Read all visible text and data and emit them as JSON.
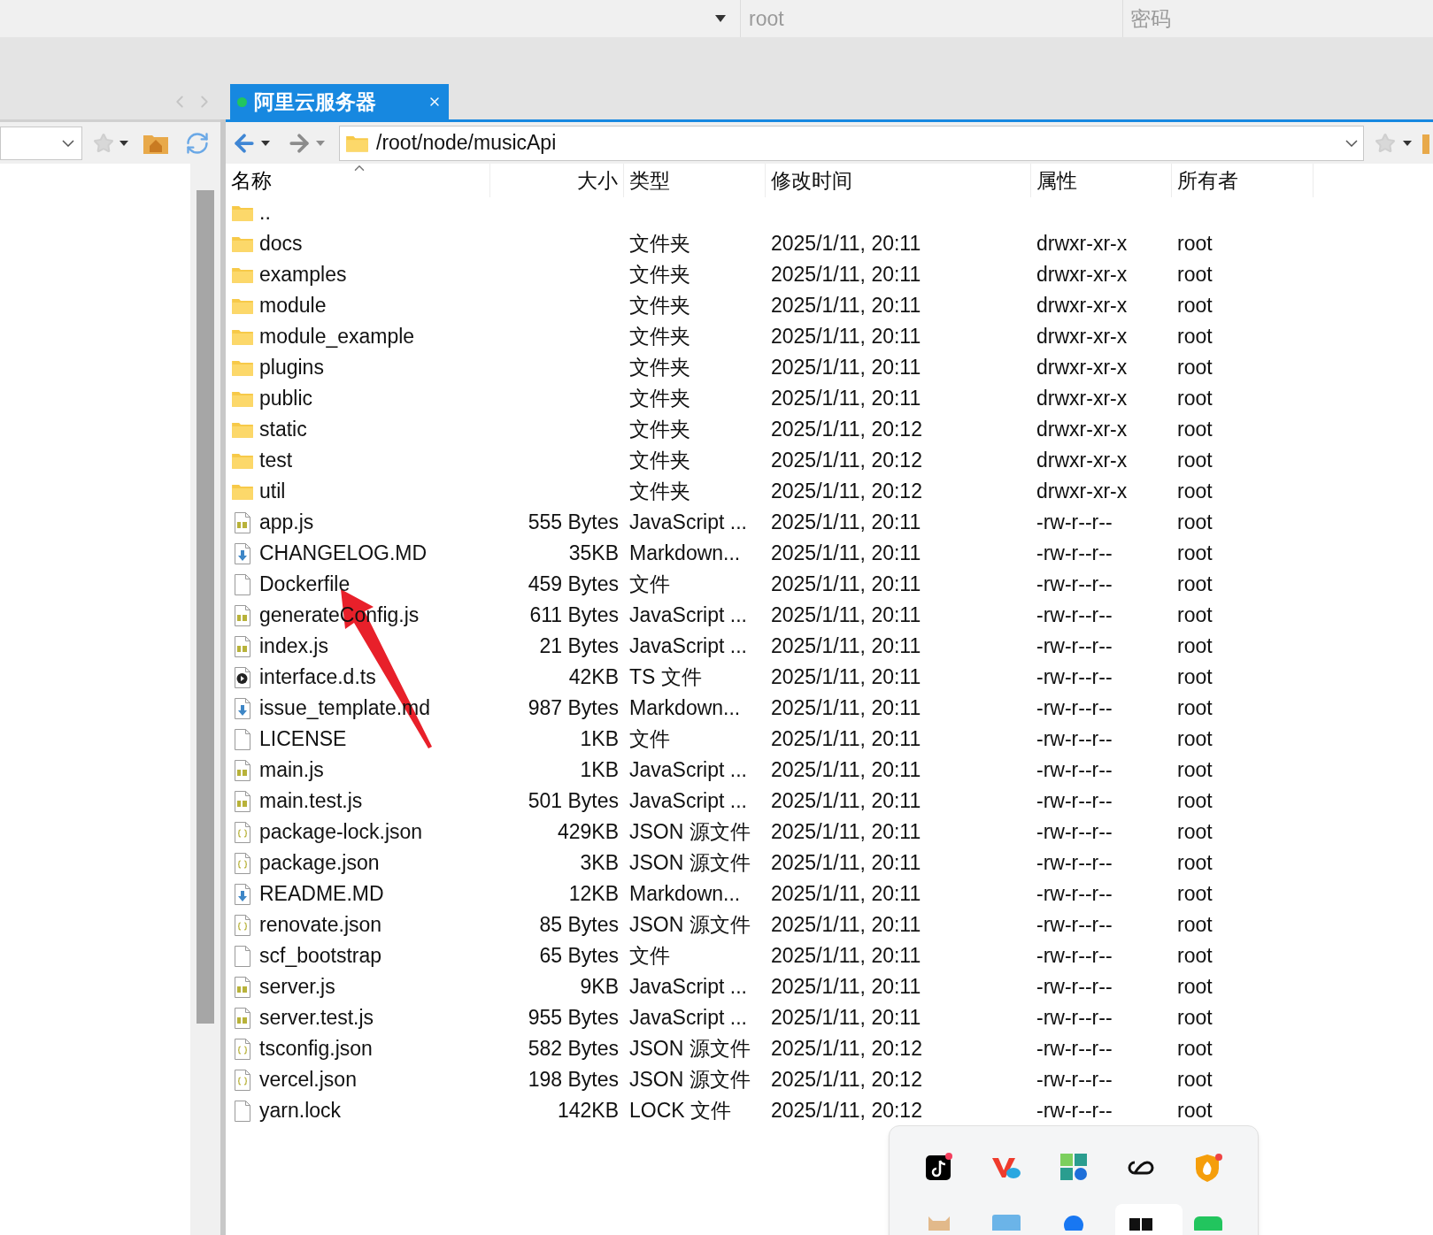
{
  "login_bar": {
    "user_field": {
      "placeholder": "root"
    },
    "password_field": {
      "placeholder": "密码"
    }
  },
  "tabs": [
    {
      "label": "阿里云服务器",
      "selected": true,
      "connected": true
    }
  ],
  "remote": {
    "path": "/root/node/musicApi",
    "columns": [
      {
        "label": "名称",
        "sorted": true
      },
      {
        "label": "大小",
        "sorted": false
      },
      {
        "label": "类型",
        "sorted": false
      },
      {
        "label": "修改时间",
        "sorted": false
      },
      {
        "label": "属性",
        "sorted": false
      },
      {
        "label": "所有者",
        "sorted": false
      }
    ],
    "rows": [
      {
        "kind": "folder",
        "name": ".."
      },
      {
        "kind": "folder",
        "name": "docs",
        "type": "文件夹",
        "modified": "2025/1/11, 20:11",
        "attrs": "drwxr-xr-x",
        "owner": "root"
      },
      {
        "kind": "folder",
        "name": "examples",
        "type": "文件夹",
        "modified": "2025/1/11, 20:11",
        "attrs": "drwxr-xr-x",
        "owner": "root"
      },
      {
        "kind": "folder",
        "name": "module",
        "type": "文件夹",
        "modified": "2025/1/11, 20:11",
        "attrs": "drwxr-xr-x",
        "owner": "root"
      },
      {
        "kind": "folder",
        "name": "module_example",
        "type": "文件夹",
        "modified": "2025/1/11, 20:11",
        "attrs": "drwxr-xr-x",
        "owner": "root"
      },
      {
        "kind": "folder",
        "name": "plugins",
        "type": "文件夹",
        "modified": "2025/1/11, 20:11",
        "attrs": "drwxr-xr-x",
        "owner": "root"
      },
      {
        "kind": "folder",
        "name": "public",
        "type": "文件夹",
        "modified": "2025/1/11, 20:11",
        "attrs": "drwxr-xr-x",
        "owner": "root"
      },
      {
        "kind": "folder",
        "name": "static",
        "type": "文件夹",
        "modified": "2025/1/11, 20:12",
        "attrs": "drwxr-xr-x",
        "owner": "root"
      },
      {
        "kind": "folder",
        "name": "test",
        "type": "文件夹",
        "modified": "2025/1/11, 20:12",
        "attrs": "drwxr-xr-x",
        "owner": "root"
      },
      {
        "kind": "folder",
        "name": "util",
        "type": "文件夹",
        "modified": "2025/1/11, 20:12",
        "attrs": "drwxr-xr-x",
        "owner": "root"
      },
      {
        "kind": "js",
        "name": "app.js",
        "size": "555 Bytes",
        "type": "JavaScript ...",
        "modified": "2025/1/11, 20:11",
        "attrs": "-rw-r--r--",
        "owner": "root"
      },
      {
        "kind": "markdown",
        "name": "CHANGELOG.MD",
        "size": "35KB",
        "type": "Markdown...",
        "modified": "2025/1/11, 20:11",
        "attrs": "-rw-r--r--",
        "owner": "root"
      },
      {
        "kind": "file",
        "name": "Dockerfile",
        "size": "459 Bytes",
        "type": "文件",
        "modified": "2025/1/11, 20:11",
        "attrs": "-rw-r--r--",
        "owner": "root"
      },
      {
        "kind": "js",
        "name": "generateConfig.js",
        "size": "611 Bytes",
        "type": "JavaScript ...",
        "modified": "2025/1/11, 20:11",
        "attrs": "-rw-r--r--",
        "owner": "root"
      },
      {
        "kind": "js",
        "name": "index.js",
        "size": "21 Bytes",
        "type": "JavaScript ...",
        "modified": "2025/1/11, 20:11",
        "attrs": "-rw-r--r--",
        "owner": "root"
      },
      {
        "kind": "ts",
        "name": "interface.d.ts",
        "size": "42KB",
        "type": "TS 文件",
        "modified": "2025/1/11, 20:11",
        "attrs": "-rw-r--r--",
        "owner": "root"
      },
      {
        "kind": "markdown",
        "name": "issue_template.md",
        "size": "987 Bytes",
        "type": "Markdown...",
        "modified": "2025/1/11, 20:11",
        "attrs": "-rw-r--r--",
        "owner": "root"
      },
      {
        "kind": "file",
        "name": "LICENSE",
        "size": "1KB",
        "type": "文件",
        "modified": "2025/1/11, 20:11",
        "attrs": "-rw-r--r--",
        "owner": "root"
      },
      {
        "kind": "js",
        "name": "main.js",
        "size": "1KB",
        "type": "JavaScript ...",
        "modified": "2025/1/11, 20:11",
        "attrs": "-rw-r--r--",
        "owner": "root"
      },
      {
        "kind": "js",
        "name": "main.test.js",
        "size": "501 Bytes",
        "type": "JavaScript ...",
        "modified": "2025/1/11, 20:11",
        "attrs": "-rw-r--r--",
        "owner": "root"
      },
      {
        "kind": "json",
        "name": "package-lock.json",
        "size": "429KB",
        "type": "JSON 源文件",
        "modified": "2025/1/11, 20:11",
        "attrs": "-rw-r--r--",
        "owner": "root"
      },
      {
        "kind": "json",
        "name": "package.json",
        "size": "3KB",
        "type": "JSON 源文件",
        "modified": "2025/1/11, 20:11",
        "attrs": "-rw-r--r--",
        "owner": "root"
      },
      {
        "kind": "markdown",
        "name": "README.MD",
        "size": "12KB",
        "type": "Markdown...",
        "modified": "2025/1/11, 20:11",
        "attrs": "-rw-r--r--",
        "owner": "root"
      },
      {
        "kind": "json",
        "name": "renovate.json",
        "size": "85 Bytes",
        "type": "JSON 源文件",
        "modified": "2025/1/11, 20:11",
        "attrs": "-rw-r--r--",
        "owner": "root"
      },
      {
        "kind": "file",
        "name": "scf_bootstrap",
        "size": "65 Bytes",
        "type": "文件",
        "modified": "2025/1/11, 20:11",
        "attrs": "-rw-r--r--",
        "owner": "root"
      },
      {
        "kind": "js",
        "name": "server.js",
        "size": "9KB",
        "type": "JavaScript ...",
        "modified": "2025/1/11, 20:11",
        "attrs": "-rw-r--r--",
        "owner": "root"
      },
      {
        "kind": "js",
        "name": "server.test.js",
        "size": "955 Bytes",
        "type": "JavaScript ...",
        "modified": "2025/1/11, 20:11",
        "attrs": "-rw-r--r--",
        "owner": "root"
      },
      {
        "kind": "json",
        "name": "tsconfig.json",
        "size": "582 Bytes",
        "type": "JSON 源文件",
        "modified": "2025/1/11, 20:12",
        "attrs": "-rw-r--r--",
        "owner": "root"
      },
      {
        "kind": "json",
        "name": "vercel.json",
        "size": "198 Bytes",
        "type": "JSON 源文件",
        "modified": "2025/1/11, 20:12",
        "attrs": "-rw-r--r--",
        "owner": "root"
      },
      {
        "kind": "file",
        "name": "yarn.lock",
        "size": "142KB",
        "type": "LOCK 文件",
        "modified": "2025/1/11, 20:12",
        "attrs": "-rw-r--r--",
        "owner": "root"
      }
    ]
  }
}
